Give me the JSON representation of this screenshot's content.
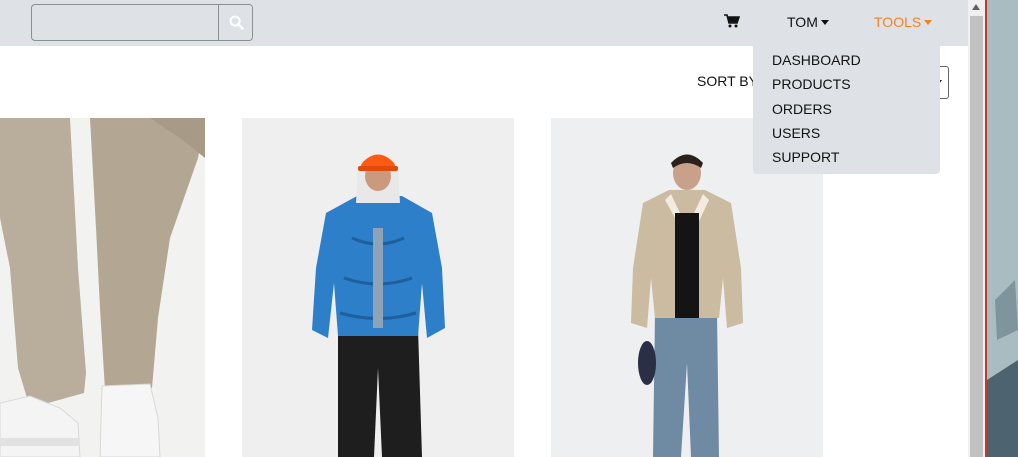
{
  "search": {
    "value": "",
    "placeholder": "",
    "button_icon": "search-icon"
  },
  "nav": {
    "cart_icon": "shopping-cart-icon",
    "user_label": "TOM",
    "tools_label": "TOOLS",
    "tools_color": "#f5821f"
  },
  "tools_menu": {
    "items": [
      "DASHBOARD",
      "PRODUCTS",
      "ORDERS",
      "USERS",
      "SUPPORT"
    ]
  },
  "sort": {
    "label": "SORT BY",
    "selected": ""
  },
  "products": [
    {
      "image": "beige-trousers-white-sneakers-photo"
    },
    {
      "image": "blue-puffer-jacket-orange-cap-photo"
    },
    {
      "image": "shearling-jacket-jeans-photo"
    }
  ],
  "colors": {
    "navbar_bg": "#dee2e6",
    "accent": "#f5821f"
  }
}
